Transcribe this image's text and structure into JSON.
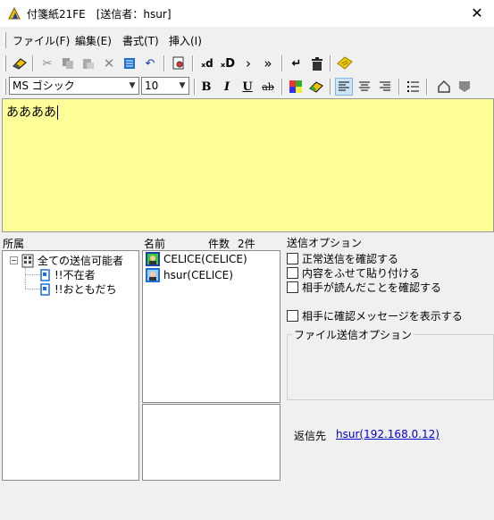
{
  "window": {
    "title": "付箋紙21FE　[送信者：hsur]",
    "close_label": "✕"
  },
  "menu": [
    {
      "label": "ファイル(F)"
    },
    {
      "label": "編集(E)"
    },
    {
      "label": "書式(T)"
    },
    {
      "label": "挿入(I)"
    }
  ],
  "toolbar_icons": [
    "eraser-icon",
    "cut-icon",
    "copy-icon",
    "paste-icon",
    "delete-icon",
    "select-all-icon",
    "undo-icon",
    "preview-icon",
    "prev-note-icon",
    "next-note-icon",
    "forward-icon",
    "fast-forward-icon",
    "wrap-icon",
    "trash-icon",
    "sticky-note-icon"
  ],
  "format": {
    "font_name": "MS ゴシック",
    "font_size": "10",
    "bold_label": "B",
    "italic_label": "I",
    "underline_label": "U",
    "strike_label": "ab"
  },
  "editor": {
    "text": "ああああ"
  },
  "affiliation": {
    "heading": "所属",
    "root": "全ての送信可能者",
    "toggle": "−",
    "children": [
      "!!不在者",
      "!!おともだち"
    ]
  },
  "recipients": {
    "name_header": "名前",
    "count_header": "件数",
    "count_value": "2件",
    "items": [
      "CELICE(CELICE)",
      "hsur(CELICE)"
    ]
  },
  "send_options": {
    "heading": "送信オプション",
    "checkboxes": [
      "正常送信を確認する",
      "内容をふせて貼り付ける",
      "相手が読んだことを確認する"
    ],
    "confirm_message": "相手に確認メッセージを表示する",
    "file_options_heading": "ファイル送信オプション"
  },
  "reply": {
    "label": "返信先",
    "address": "hsur(192.168.0.12)"
  },
  "colors": {
    "editor_bg": "#ffff99",
    "link": "#0000cc",
    "selection": "#cce4f7"
  }
}
